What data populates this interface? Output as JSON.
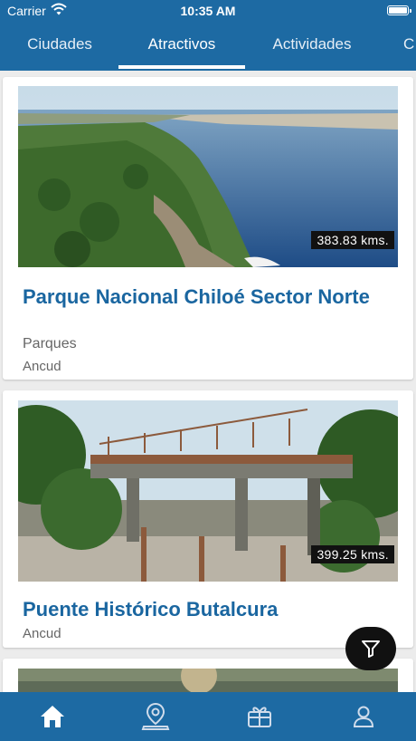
{
  "status": {
    "carrier": "Carrier",
    "time": "10:35 AM"
  },
  "tabs": [
    {
      "label": "Ciudades",
      "active": false
    },
    {
      "label": "Atractivos",
      "active": true
    },
    {
      "label": "Actividades",
      "active": false
    },
    {
      "label": "C",
      "active": false
    }
  ],
  "cards": [
    {
      "title": "Parque Nacional Chiloé Sector Norte",
      "category": "Parques",
      "location": "Ancud",
      "distance": "383.83 kms."
    },
    {
      "title": "Puente Histórico Butalcura",
      "location": "Ancud",
      "distance": "399.25 kms."
    }
  ],
  "colors": {
    "primary": "#1d6aa3",
    "title": "#1a66a0"
  },
  "bottom_nav": [
    {
      "icon": "home-icon",
      "active": true
    },
    {
      "icon": "map-pin-icon"
    },
    {
      "icon": "gift-icon"
    },
    {
      "icon": "user-icon"
    }
  ],
  "fab": {
    "icon": "filter-icon"
  }
}
